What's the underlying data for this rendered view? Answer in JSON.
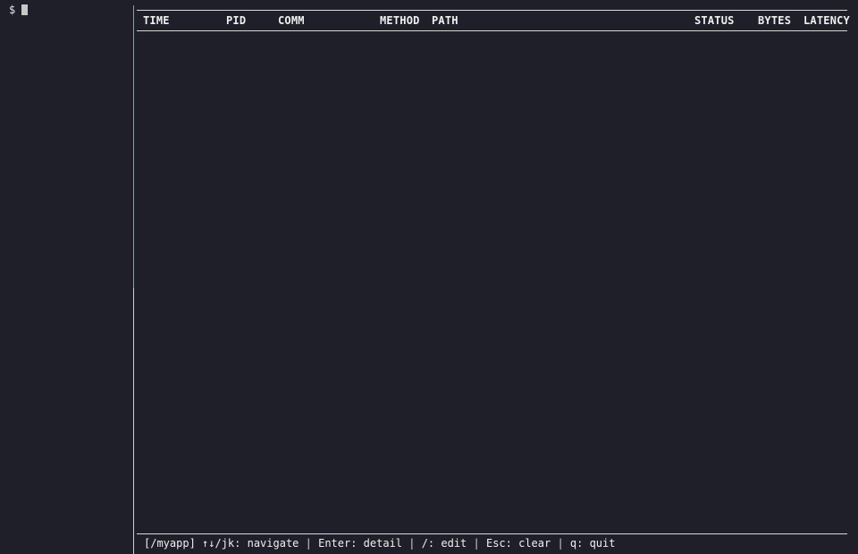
{
  "terminal": {
    "prompt": "$"
  },
  "table": {
    "columns": {
      "time": "TIME",
      "pid": "PID",
      "comm": "COMM",
      "method": "METHOD",
      "path": "PATH",
      "status": "STATUS",
      "bytes": "BYTES",
      "latency": "LATENCY"
    },
    "rows": []
  },
  "status_bar": {
    "filter": "[/myapp]",
    "navigate": "↑↓/jk: navigate",
    "detail": "Enter: detail",
    "edit": "/: edit",
    "clear": "Esc: clear",
    "quit": "q: quit",
    "separator": " | "
  },
  "colors": {
    "background": "#1e1f29",
    "active_pane_border": "#3fcf6a",
    "text": "#e6e6e6"
  }
}
